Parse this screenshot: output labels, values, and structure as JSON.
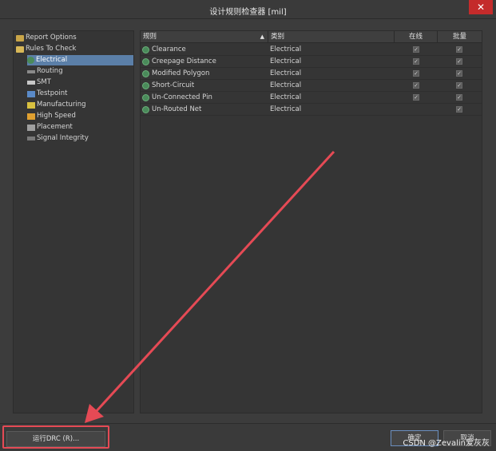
{
  "window": {
    "title": "设计规则检查器 [mil]",
    "close_label": "✕"
  },
  "tree": {
    "items": [
      {
        "label": "Report Options",
        "icon": "folder-icon"
      },
      {
        "label": "Rules To Check",
        "icon": "folder-open-icon"
      },
      {
        "label": "Electrical",
        "icon": "electrical-icon",
        "selected": true
      },
      {
        "label": "Routing",
        "icon": "routing-icon"
      },
      {
        "label": "SMT",
        "icon": "smt-icon"
      },
      {
        "label": "Testpoint",
        "icon": "testpoint-icon"
      },
      {
        "label": "Manufacturing",
        "icon": "manufacturing-icon"
      },
      {
        "label": "High Speed",
        "icon": "high-speed-icon"
      },
      {
        "label": "Placement",
        "icon": "placement-icon"
      },
      {
        "label": "Signal Integrity",
        "icon": "signal-integrity-icon"
      }
    ]
  },
  "table": {
    "headers": {
      "rule": "规则",
      "category": "类别",
      "online": "在线",
      "batch": "批量"
    },
    "rows": [
      {
        "rule": "Clearance",
        "category": "Electrical",
        "online": true,
        "batch": true
      },
      {
        "rule": "Creepage Distance",
        "category": "Electrical",
        "online": true,
        "batch": true
      },
      {
        "rule": "Modified Polygon",
        "category": "Electrical",
        "online": true,
        "batch": true
      },
      {
        "rule": "Short-Circuit",
        "category": "Electrical",
        "online": true,
        "batch": true
      },
      {
        "rule": "Un-Connected Pin",
        "category": "Electrical",
        "online": true,
        "batch": true
      },
      {
        "rule": "Un-Routed Net",
        "category": "Electrical",
        "online": false,
        "batch": true
      }
    ]
  },
  "buttons": {
    "run_drc": "运行DRC (R)...",
    "ok": "确定",
    "cancel": "取消"
  },
  "watermark": "CSDN @Zevalin爱灰灰",
  "colors": {
    "highlight": "#e54a55",
    "selection": "#5b7fa8"
  }
}
